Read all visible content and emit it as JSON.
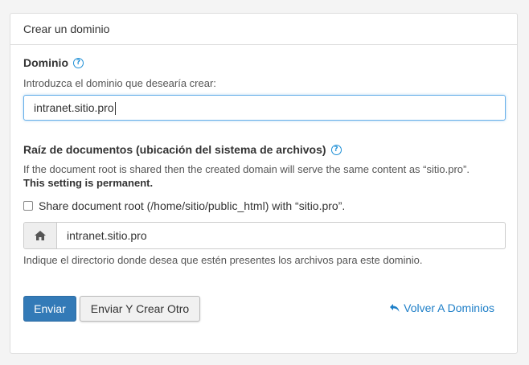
{
  "panel": {
    "title": "Crear un dominio"
  },
  "domain": {
    "label": "Dominio",
    "hint": "Introduzca el dominio que desearía crear:",
    "value": "intranet.sitio.pro"
  },
  "docroot": {
    "label": "Raíz de documentos (ubicación del sistema de archivos)",
    "info": "If the document root is shared then the created domain will serve the same content as “sitio.pro”.",
    "permanent": "This setting is permanent.",
    "share_label": "Share document root (/home/sitio/public_html) with “sitio.pro”.",
    "share_checked": false,
    "value": "intranet.sitio.pro",
    "hint": "Indique el directorio donde desea que estén presentes los archivos para este dominio."
  },
  "actions": {
    "submit": "Enviar",
    "submit_another": "Enviar Y Crear Otro",
    "back": "Volver A Dominios"
  },
  "icons": {
    "help": "help-circle-icon",
    "home": "home-icon",
    "back": "undo-arrow-icon"
  },
  "colors": {
    "primary": "#337ab7",
    "link": "#1e7fc8",
    "help": "#1e8fd6"
  }
}
